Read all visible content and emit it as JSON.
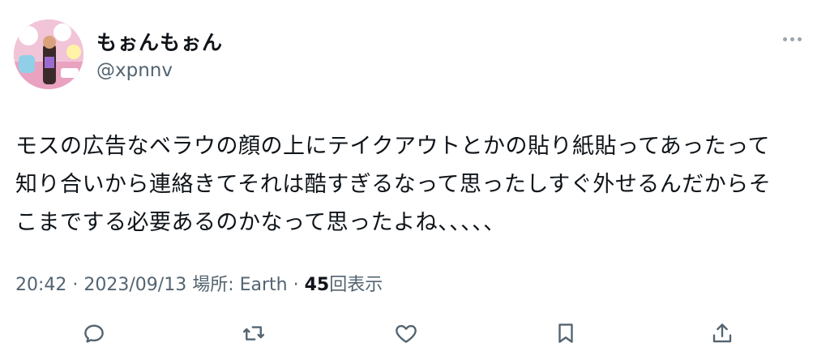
{
  "author": {
    "display_name": "もぉんもぉん",
    "handle": "@xpnnv"
  },
  "tweet": {
    "lines": [
      "モスの広告なベラウの顔の上にテイクアウトとかの貼り紙貼ってあったって",
      "知り合いから連絡きてそれは酷すぎるなって思ったしすぐ外せるんだからそ",
      "こまでする必要あるのかなって思ったよね、、、、、"
    ]
  },
  "meta": {
    "time": "20:42",
    "date": "2023/09/13",
    "location": "場所: Earth",
    "separator": "·",
    "views_count": "45",
    "views_label": "回表示"
  },
  "icons": {
    "more": "more-horizontal-icon",
    "reply": "reply-icon",
    "retweet": "retweet-icon",
    "like": "heart-icon",
    "bookmark": "bookmark-icon",
    "share": "share-icon"
  },
  "colors": {
    "text_primary": "#0f1419",
    "text_secondary": "#536471",
    "icon": "#536471"
  }
}
